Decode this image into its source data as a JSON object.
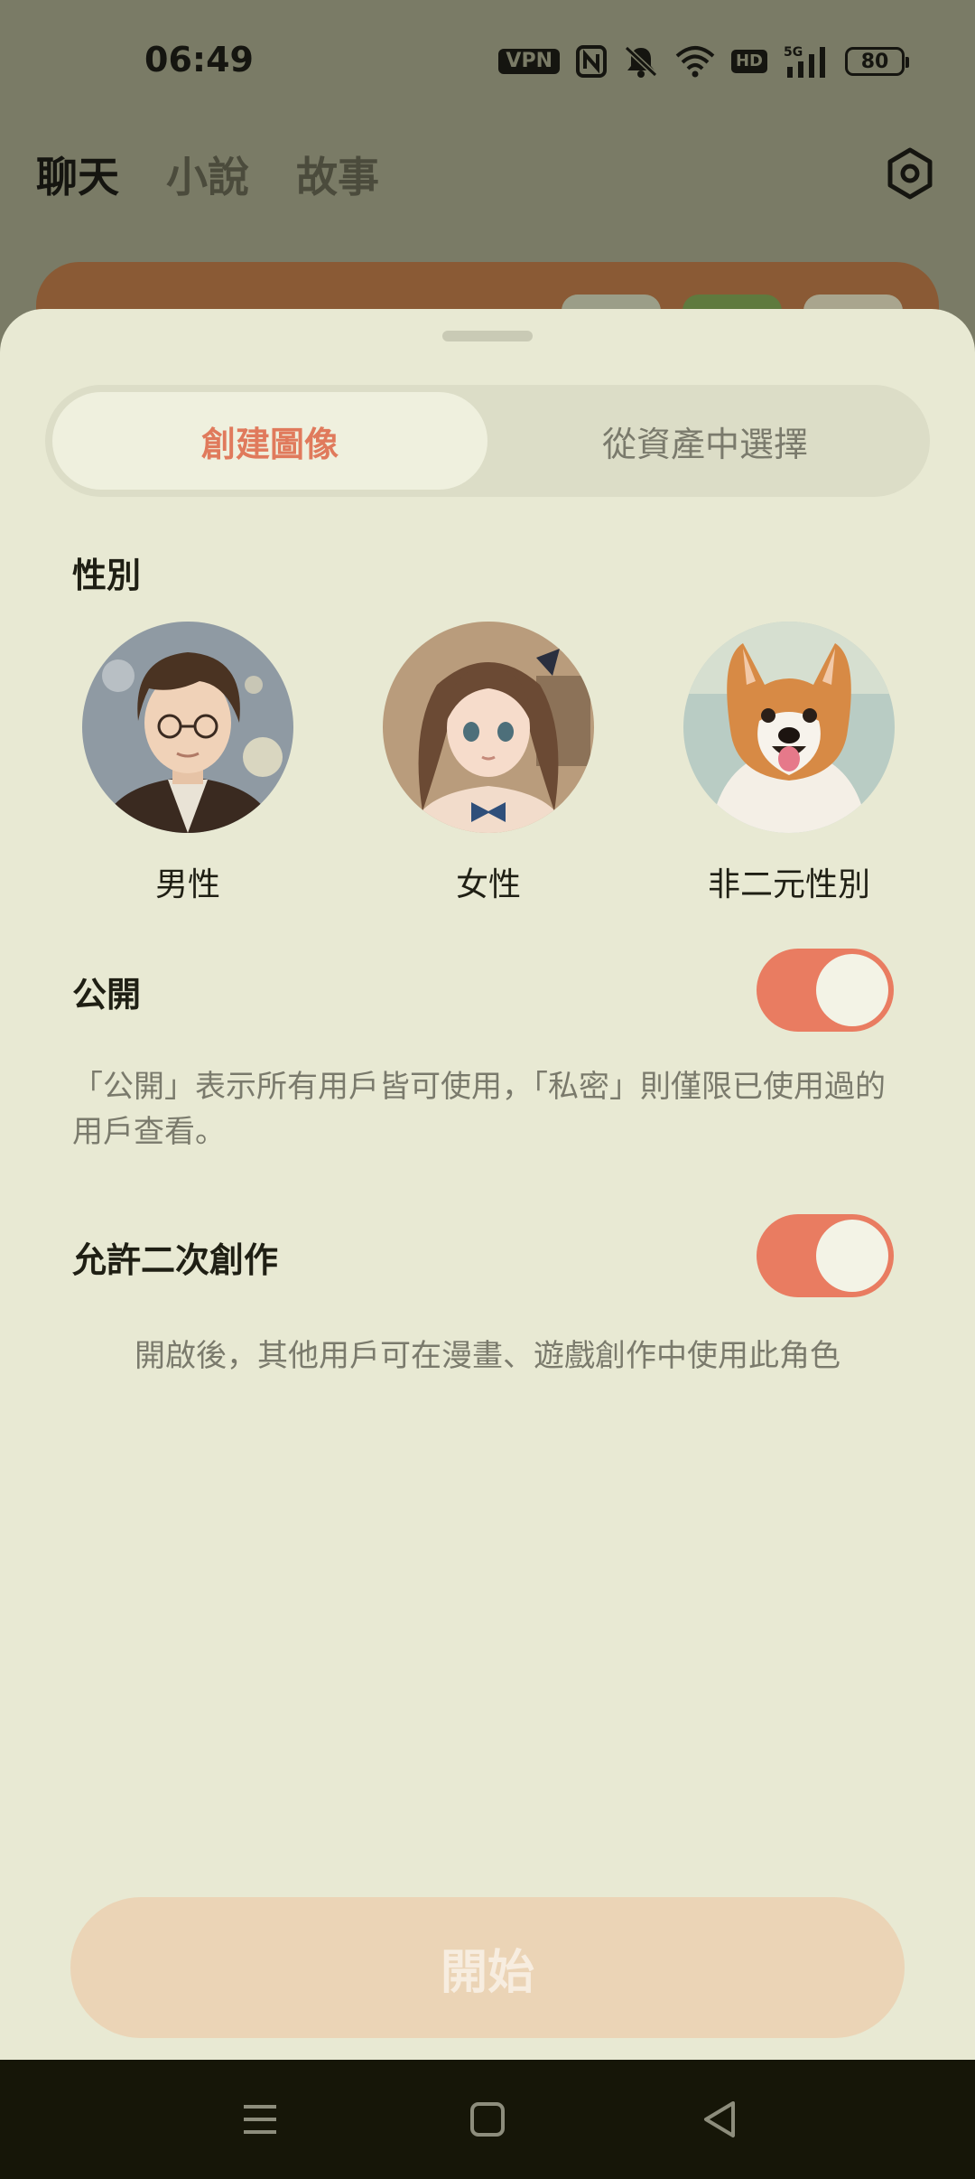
{
  "status_bar": {
    "time": "06:49",
    "vpn": "VPN",
    "hd": "HD",
    "network": "5G",
    "battery": "80"
  },
  "top_nav": {
    "tabs": [
      "聊天",
      "小說",
      "故事"
    ],
    "active_tab": "聊天"
  },
  "sheet": {
    "segmented": {
      "create": "創建圖像",
      "from_assets": "從資產中選擇"
    },
    "gender": {
      "title": "性別",
      "options": [
        "男性",
        "女性",
        "非二元性別"
      ]
    },
    "public": {
      "title": "公開",
      "enabled": true,
      "description": "「公開」表示所有用戶皆可使用，「私密」則僅限已使用過的用戶查看。"
    },
    "remix": {
      "title": "允許二次創作",
      "enabled": true,
      "description": "開啟後，其他用戶可在漫畫、遊戲創作中使用此角色"
    },
    "start_button": "開始"
  },
  "colors": {
    "accent": "#e97c61",
    "sheet_bg": "#e8e9d3",
    "start_button_disabled": "#ebd4b6"
  }
}
